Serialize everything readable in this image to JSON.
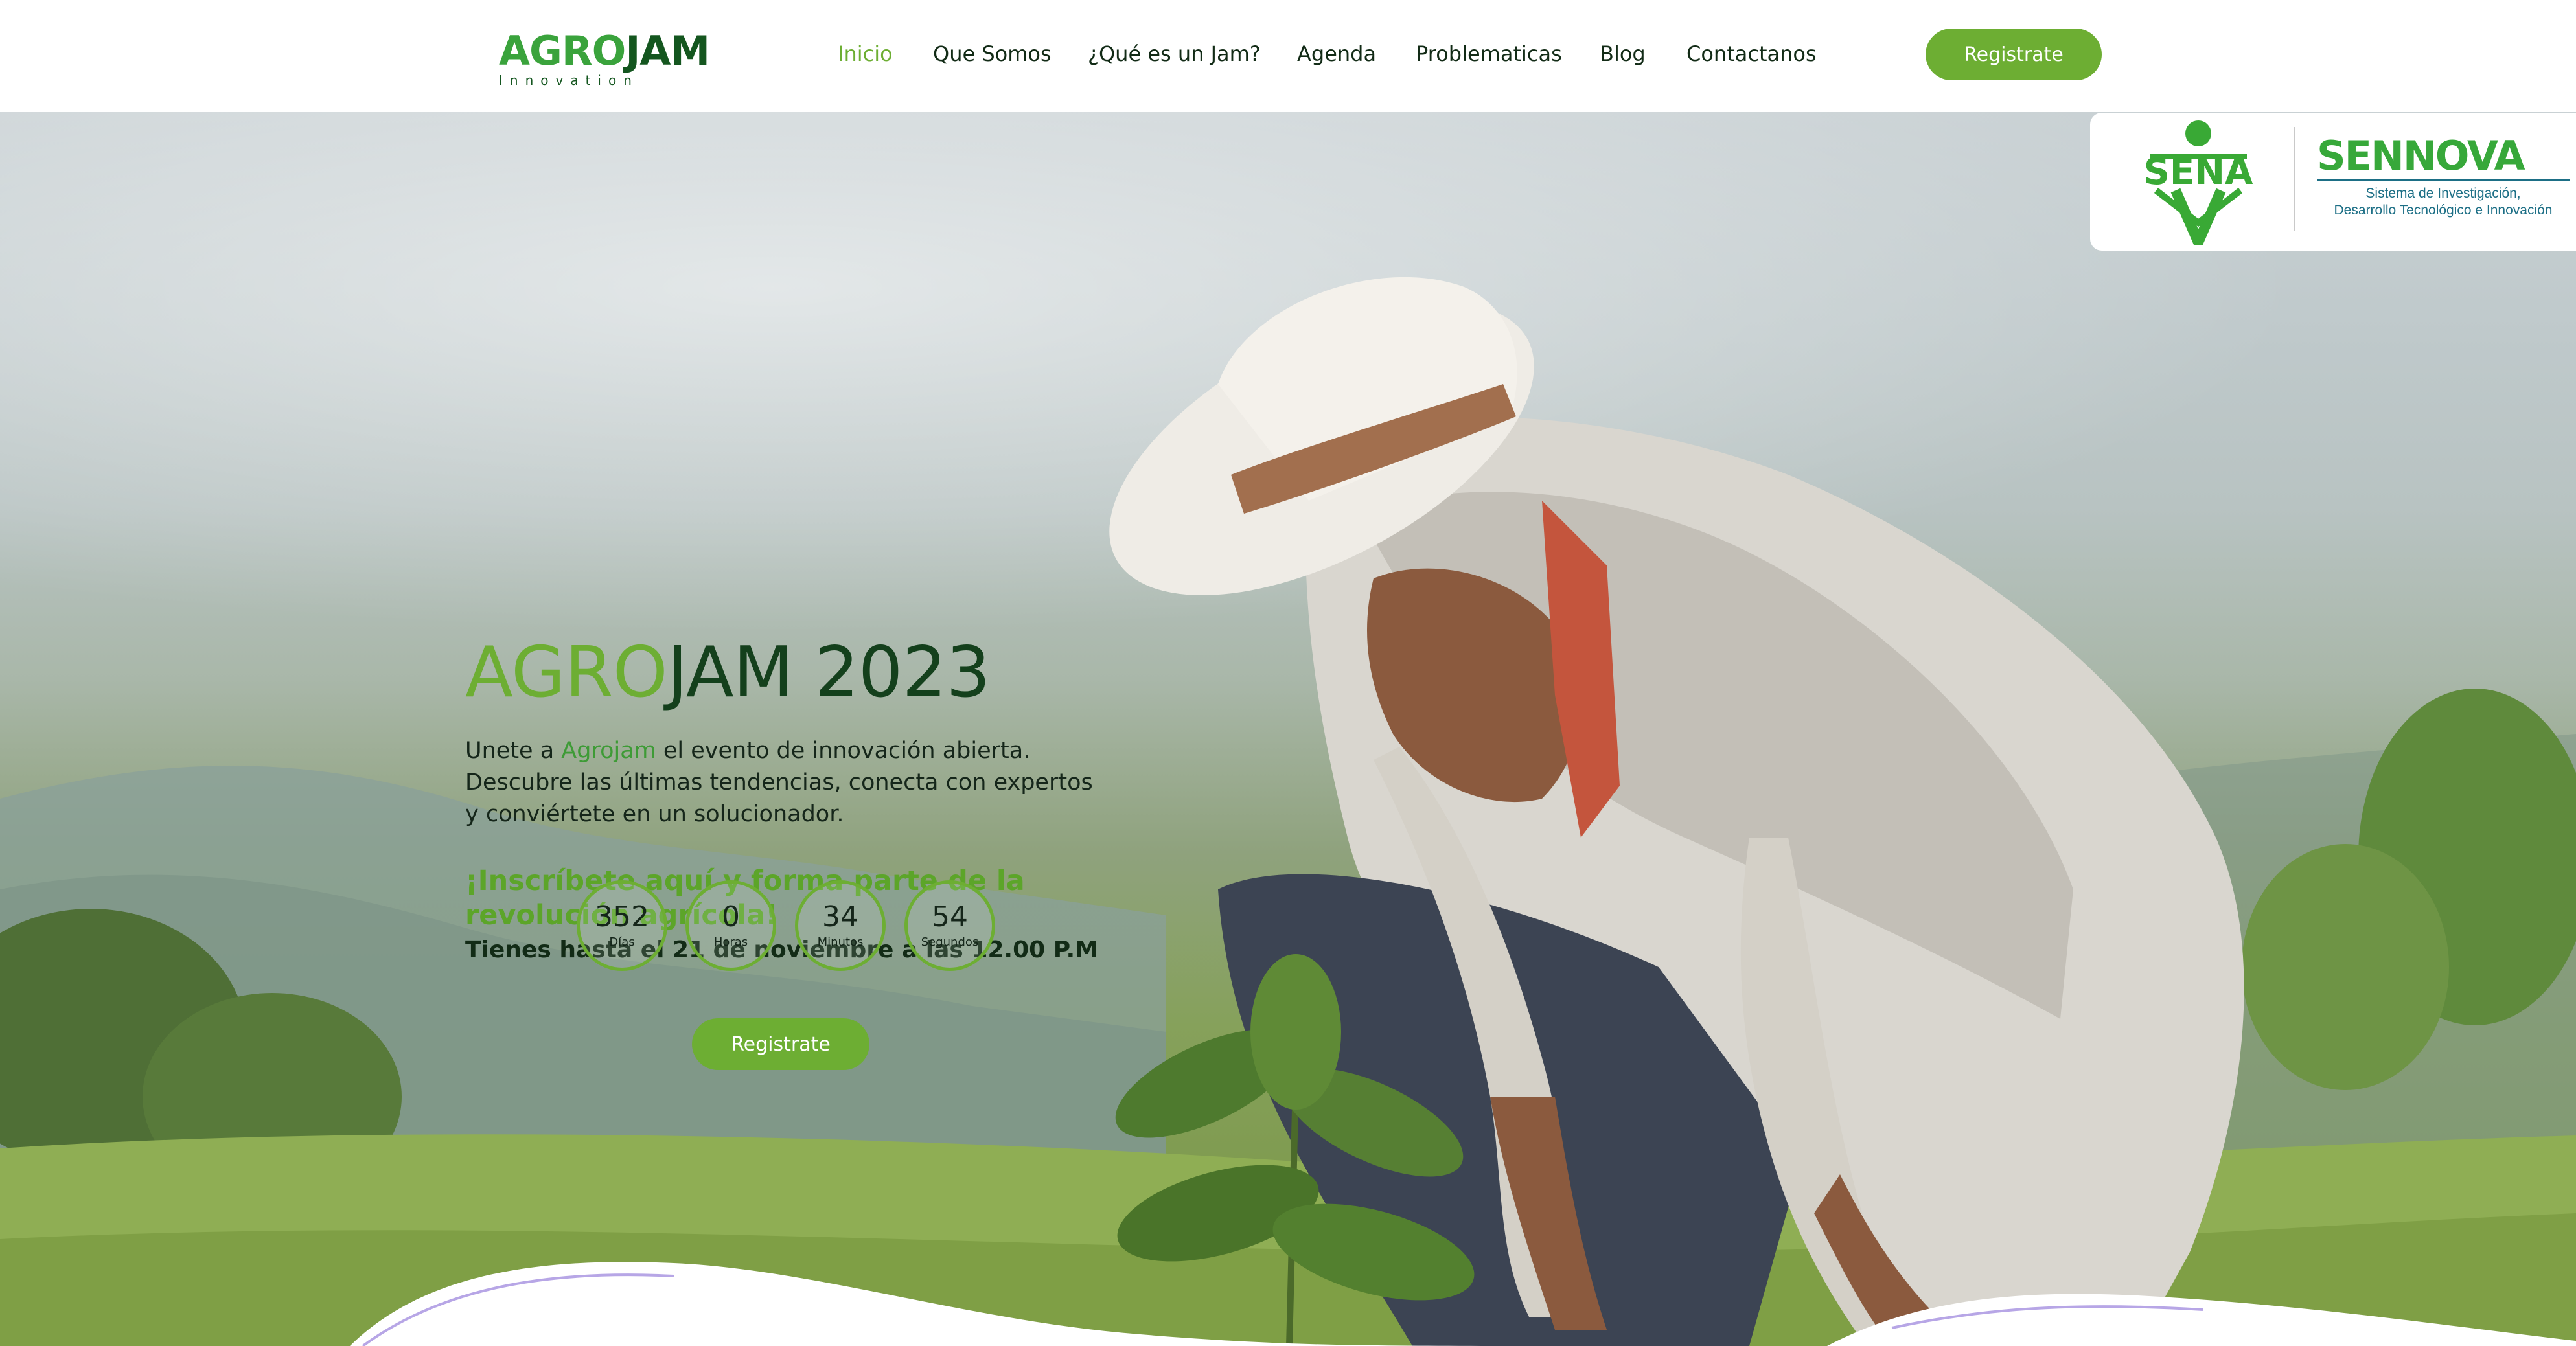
{
  "header": {
    "logo": {
      "agro": "AGRO",
      "jam": "JAM",
      "sub": "Innovation"
    },
    "nav": [
      {
        "label": "Inicio",
        "active": true
      },
      {
        "label": "Que Somos",
        "active": false
      },
      {
        "label": "¿Qué es un Jam?",
        "active": false
      },
      {
        "label": "Agenda",
        "active": false
      },
      {
        "label": "Problematicas",
        "active": false
      },
      {
        "label": "Blog",
        "active": false
      },
      {
        "label": "Contactanos",
        "active": false
      }
    ],
    "register_label": "Registrate"
  },
  "partners": {
    "sena": "SENA",
    "sennova_title": "SENNOVA",
    "sennova_sub_1": "Sistema de Investigación,",
    "sennova_sub_2": "Desarrollo Tecnológico e Innovación"
  },
  "hero": {
    "title_agro": "AGRO",
    "title_rest": "JAM 2023",
    "desc_prefix": "Unete a ",
    "desc_highlight": "Agrojam",
    "desc_suffix": " el evento de innovación abierta. Descubre las últimas tendencias, conecta con expertos y conviértete en un solucionador.",
    "cta": "¡Inscríbete aquí y forma parte de la revolución agrícola!",
    "deadline": "Tienes hasta el 21 de noviembre a las 12.00 P.M",
    "countdown": [
      {
        "value": "352",
        "label": "Días"
      },
      {
        "value": "0",
        "label": "Horas"
      },
      {
        "value": "34",
        "label": "Minutos"
      },
      {
        "value": "54",
        "label": "Segundos"
      }
    ],
    "register_label": "Registrate"
  },
  "colors": {
    "brand_green": "#6dae33",
    "dark_green": "#14401c",
    "text_dark": "#122b16",
    "white": "#ffffff"
  },
  "icons": {
    "sena_logo": "sena-logo-icon",
    "sennova_logo": "sennova-logo-icon"
  }
}
